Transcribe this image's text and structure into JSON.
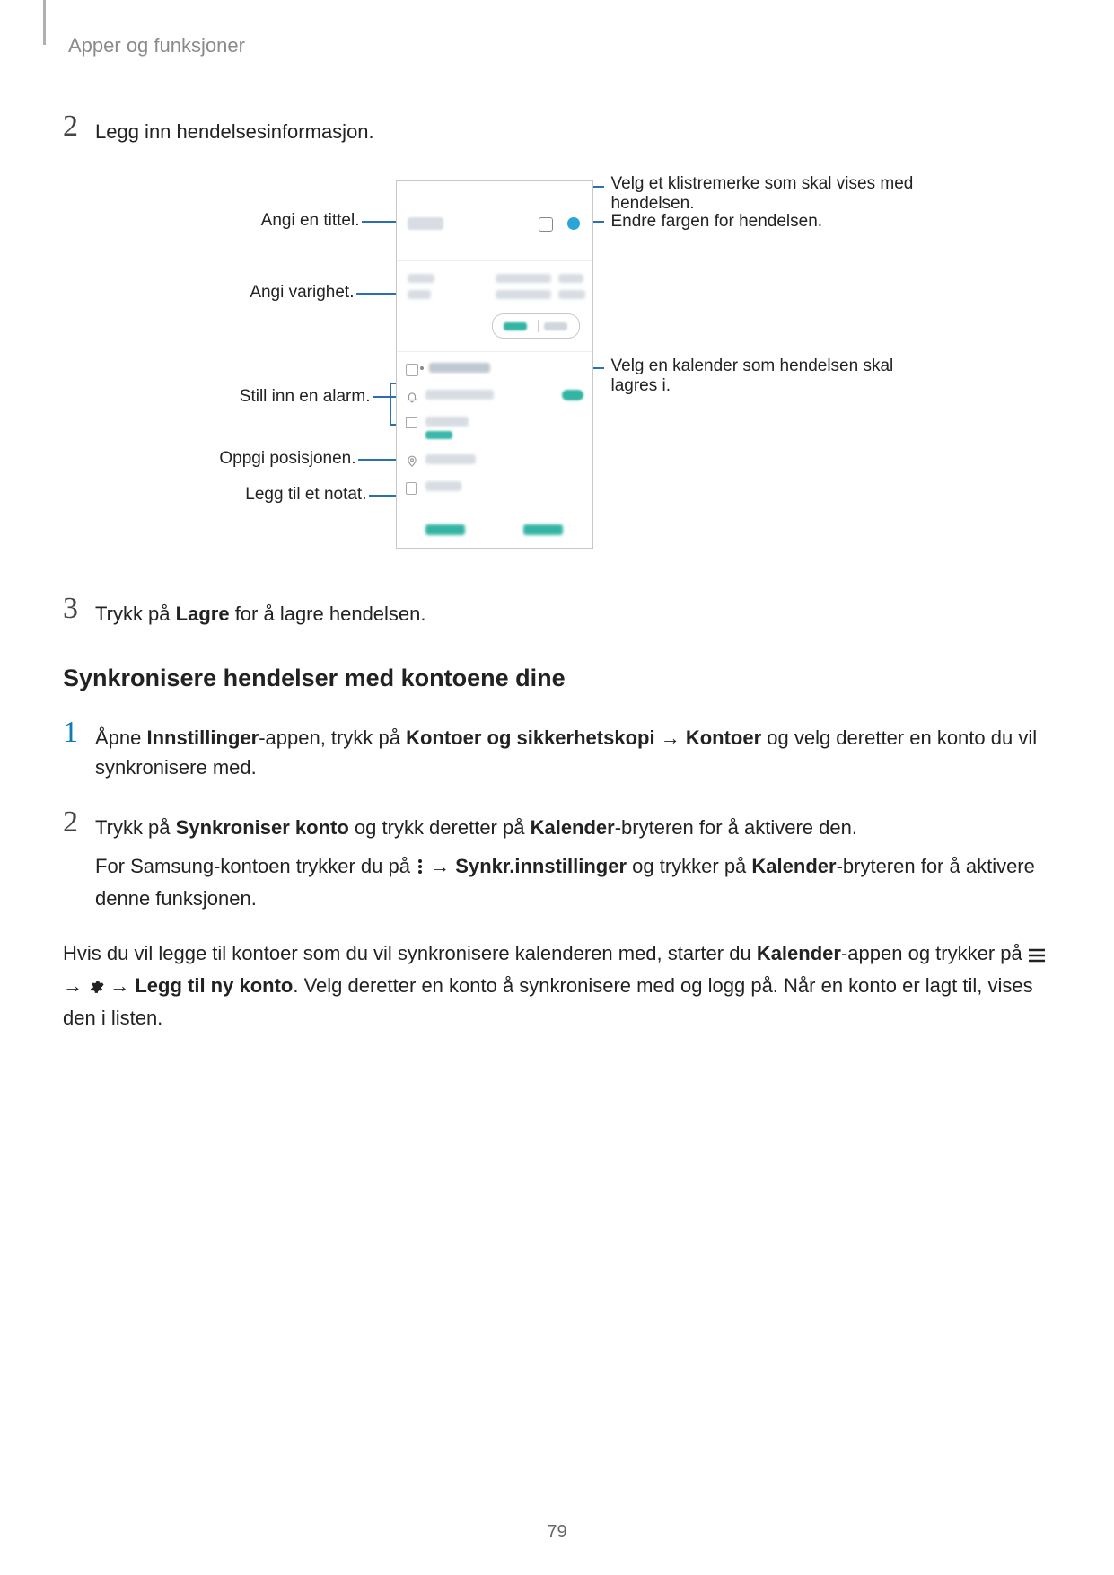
{
  "breadcrumb": "Apper og funksjoner",
  "step2": {
    "num": "2",
    "text": "Legg inn hendelsesinformasjon."
  },
  "diagram": {
    "left": {
      "title": "Angi en tittel.",
      "duration": "Angi varighet.",
      "alarm": "Still inn en alarm.",
      "location": "Oppgi posisjonen.",
      "note": "Legg til et notat."
    },
    "right": {
      "sticker": "Velg et klistremerke som skal vises med hendelsen.",
      "color": "Endre fargen for hendelsen.",
      "calendar": "Velg en kalender som hendelsen skal lagres i."
    }
  },
  "step3": {
    "num": "3",
    "pre": "Trykk på ",
    "bold": "Lagre",
    "post": " for å lagre hendelsen."
  },
  "section_title": "Synkronisere hendelser med kontoene dine",
  "sync1": {
    "num": "1",
    "p_pre": "Åpne ",
    "b1": "Innstillinger",
    "p_mid1": "-appen, trykk på ",
    "b2": "Kontoer og sikkerhetskopi",
    "arrow": " → ",
    "b3": "Kontoer",
    "p_post": " og velg deretter en konto du vil synkronisere med."
  },
  "sync2": {
    "num": "2",
    "l1_pre": "Trykk på ",
    "l1_b1": "Synkroniser konto",
    "l1_mid": " og trykk deretter på ",
    "l1_b2": "Kalender",
    "l1_post": "-bryteren for å aktivere den.",
    "l2_pre": "For Samsung-kontoen trykker du på ",
    "l2_arrow": " → ",
    "l2_b1": "Synkr.innstillinger",
    "l2_mid": " og trykker på ",
    "l2_b2": "Kalender",
    "l2_post": "-bryteren for å aktivere denne funksjonen."
  },
  "tail": {
    "t1": "Hvis du vil legge til kontoer som du vil synkronisere kalenderen med, starter du ",
    "b1": "Kalender",
    "t2": "-appen og trykker på ",
    "arrow": " → ",
    "b2": "Legg til ny konto",
    "t3": ". Velg deretter en konto å synkronisere med og logg på. Når en konto er lagt til, vises den i listen."
  },
  "page_number": "79"
}
